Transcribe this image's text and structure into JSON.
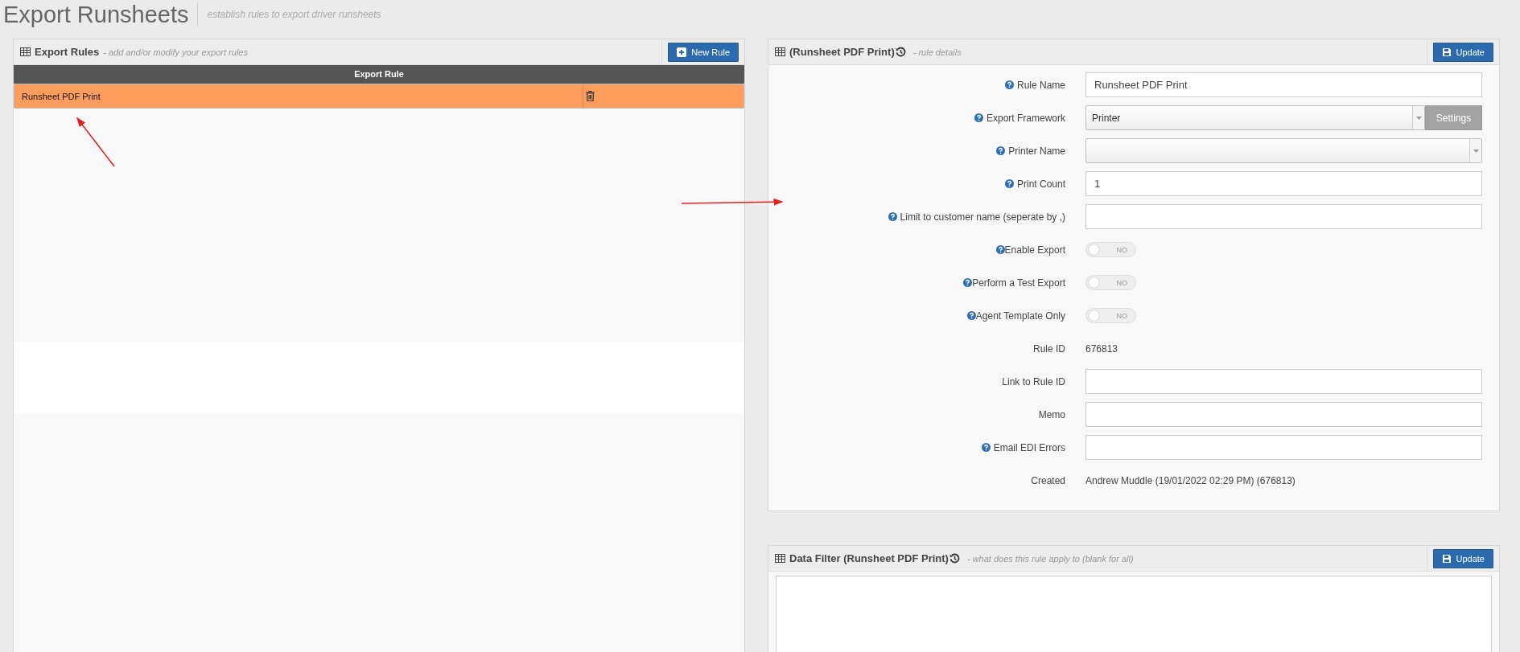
{
  "page": {
    "title": "Export Runsheets",
    "subtitle": "establish rules to export driver runsheets"
  },
  "rules_panel": {
    "title": "Export Rules",
    "subtitle": "- add and/or modify your export rules",
    "new_button": "New Rule",
    "table": {
      "columns": [
        "Export Rule"
      ],
      "rows": [
        {
          "name": "Runsheet PDF Print",
          "selected": true
        }
      ]
    }
  },
  "details_panel": {
    "title": "(Runsheet PDF Print)",
    "subtitle": "- rule details",
    "update_button": "Update",
    "fields": [
      {
        "label": "Rule Name",
        "help": true,
        "kind": "text",
        "value": "Runsheet PDF Print"
      },
      {
        "label": "Export Framework",
        "help": true,
        "kind": "select",
        "value": "Printer",
        "button": "Settings"
      },
      {
        "label": "Printer Name",
        "help": true,
        "kind": "select"
      },
      {
        "label": "Print Count",
        "help": true,
        "kind": "text",
        "value": "1"
      },
      {
        "label": "Limit to customer name (seperate by ,)",
        "help": true,
        "kind": "text"
      },
      {
        "label": "Enable Export",
        "help": true,
        "kind": "toggle",
        "on": false,
        "state_text": "NO"
      },
      {
        "label": "Perform a Test Export",
        "help": true,
        "kind": "toggle",
        "on": false,
        "state_text": "NO"
      },
      {
        "label": "Agent Template Only",
        "help": true,
        "kind": "toggle",
        "on": false,
        "state_text": "NO"
      },
      {
        "label": "Rule ID",
        "help": false,
        "kind": "static",
        "value": "676813"
      },
      {
        "label": "Link to Rule ID",
        "help": false,
        "kind": "text"
      },
      {
        "label": "Memo",
        "help": false,
        "kind": "text"
      },
      {
        "label": "Email EDI Errors",
        "help": true,
        "kind": "text"
      },
      {
        "label": "Created",
        "help": false,
        "kind": "static",
        "value": "Andrew Muddle (19/01/2022 02:29 PM) (676813)"
      }
    ]
  },
  "filter_panel": {
    "title": "Data Filter (Runsheet PDF Print)",
    "subtitle": "- what does this rule apply to (blank for all)",
    "update_button": "Update"
  }
}
